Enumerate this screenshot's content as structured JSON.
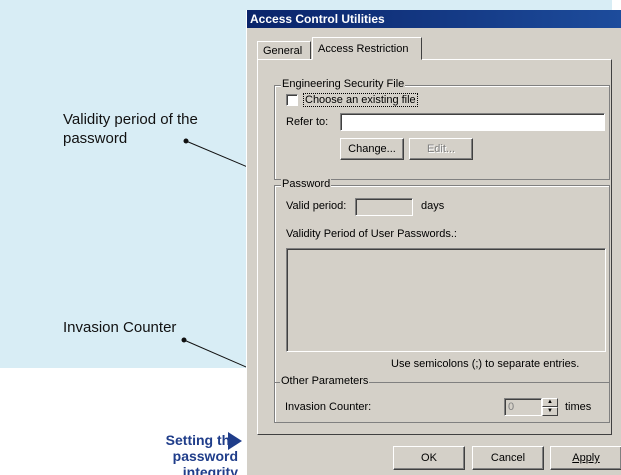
{
  "annotations": {
    "validity": "Validity period of the password",
    "invasion": "Invasion Counter",
    "integrity": "Setting the password integrity"
  },
  "dialog": {
    "title": "Access Control Utilities",
    "tabs": [
      {
        "label": "General",
        "active": false
      },
      {
        "label": "Access Restriction",
        "active": true
      }
    ],
    "security_file": {
      "legend": "Engineering Security File",
      "checkbox_label": "Choose an existing file",
      "checked": false,
      "refer_label": "Refer to:",
      "refer_value": "",
      "change_button": "Change...",
      "edit_button": "Edit..."
    },
    "password": {
      "legend": "Password",
      "valid_period_label": "Valid period:",
      "valid_period_value": "",
      "days_label": "days",
      "user_passwords_label": "Validity Period of User Passwords.:",
      "hint": "Use semicolons (;) to separate entries."
    },
    "other": {
      "legend": "Other Parameters",
      "invasion_label": "Invasion Counter:",
      "invasion_value": "0",
      "times_label": "times"
    },
    "buttons": {
      "ok": "OK",
      "cancel": "Cancel",
      "apply": "Apply"
    }
  },
  "colors": {
    "background_panel": "#d8edf5",
    "dialog_face": "#d4d0c8",
    "titlebar": "#0a246a",
    "integrity_text": "#1f3d8a"
  }
}
